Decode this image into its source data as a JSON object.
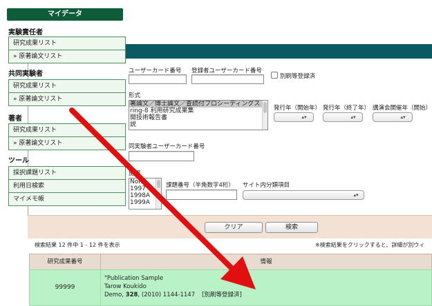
{
  "sidebar": {
    "title": "マイデータ",
    "sections": [
      {
        "heading": "実験責任者",
        "items": [
          "研究成果リスト",
          "» 原著論文リスト"
        ]
      },
      {
        "heading": "共同実験者",
        "items": [
          "研究成果リスト",
          "» 原著論文リスト"
        ]
      },
      {
        "heading": "著者",
        "items": [
          "研究成果リスト",
          "» 原著論文リスト"
        ]
      },
      {
        "heading": "ツール",
        "items": [
          "採択課題リスト",
          "利用日検索",
          "マイメモ帳"
        ]
      }
    ]
  },
  "form": {
    "user_card_label": "ユーザーカード番号",
    "registrant_card_label": "登録者ユーザーカード番号",
    "reprint_label": "別刷等登録済",
    "format_label": "形式",
    "format_options": [
      "著論文／博士論文／査読付プロシーディングス",
      "ring-8 利用研究成果集",
      "開技術報告書",
      "説"
    ],
    "pub_year_start_label": "発行年（開始年）",
    "pub_year_end_label": "発行年（終了年）",
    "conf_year_start_label": "講演会開催年（開始）",
    "coexperimenter_label": "同実験者ユーザーカード番号",
    "period_label": "施期",
    "period_options": [
      "None",
      "1997",
      "1998A",
      "1999A"
    ],
    "project_no_label": "課題番号（半角数字4桁）",
    "site_category_label": "サイト内分類項目",
    "clear_button": "クリア",
    "search_button": "検索"
  },
  "results": {
    "count_text": "検索結果 12 件中 1 - 12 件を表示",
    "note_text": "※検索結果をクリックすると、詳細が別ウィ",
    "columns": [
      "研究成果番号",
      "情報"
    ],
    "rows": [
      {
        "id": "99999",
        "title": "\"Publication Sample",
        "author": "Tarow Koukido",
        "journal": "Demo, ",
        "volume": "328",
        "pages": ", (2010) 1144-1147",
        "reprint_tag": "[別刷等登録済]"
      }
    ]
  },
  "colors": {
    "header": "#0b5a63",
    "sidebar_title": "#0f5c3a",
    "result_row": "#b9f2c6",
    "arrow": "#e01010"
  }
}
